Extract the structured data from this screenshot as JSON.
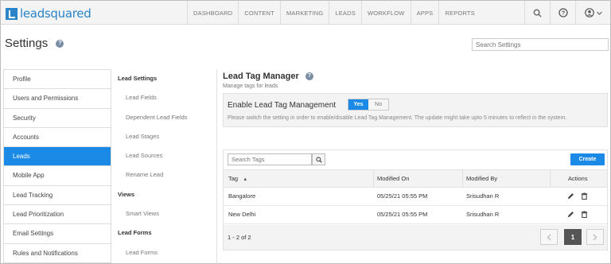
{
  "brand": {
    "name": "leadsquared"
  },
  "nav": {
    "items": [
      "DASHBOARD",
      "CONTENT",
      "MARKETING",
      "LEADS",
      "WORKFLOW",
      "APPS",
      "REPORTS"
    ]
  },
  "header": {
    "title": "Settings",
    "help_glyph": "?",
    "search_placeholder": "Search Settings"
  },
  "sidebar": {
    "items": [
      {
        "label": "Profile"
      },
      {
        "label": "Users and Permissions"
      },
      {
        "label": "Security"
      },
      {
        "label": "Accounts"
      },
      {
        "label": "Leads"
      },
      {
        "label": "Mobile App"
      },
      {
        "label": "Lead Tracking"
      },
      {
        "label": "Lead Prioritization"
      },
      {
        "label": "Email Settings"
      },
      {
        "label": "Rules and Notifications"
      }
    ],
    "active": "Leads"
  },
  "subnav": {
    "lead_settings_heading": "Lead Settings",
    "lead_settings_items": [
      "Lead Fields",
      "Dependent Lead Fields",
      "Lead Stages",
      "Lead Sources",
      "Rename Lead"
    ],
    "views_heading": "Views",
    "views_items": [
      "Smart Views"
    ],
    "lead_forms_heading": "Lead Forms",
    "lead_forms_items": [
      "Lead Forms"
    ]
  },
  "main": {
    "title": "Lead Tag Manager",
    "subtitle": "Manage tags for leads",
    "enable_label": "Enable Lead Tag Management",
    "toggle_yes": "Yes",
    "toggle_no": "No",
    "toggle_value": "Yes",
    "note": "Please switch the setting in order to enable/disable Lead Tag Management. The update might take upto 5 minutes to reflect in the system."
  },
  "table": {
    "search_placeholder": "Search Tags",
    "create_label": "Create",
    "columns": {
      "tag": "Tag",
      "sort_glyph": "▲",
      "modified_on": "Modified On",
      "modified_by": "Modified By",
      "actions": "Actions"
    },
    "rows": [
      {
        "tag": "Bangalore",
        "modified_on": "05/25/21 05:55 PM",
        "modified_by": "Srisudhan R"
      },
      {
        "tag": "New Delhi",
        "modified_on": "05/25/21 05:55 PM",
        "modified_by": "Srisudhan R"
      }
    ],
    "count_text": "1 - 2 of 2",
    "current_page": "1"
  },
  "colors": {
    "accent": "#1a8ae6",
    "brand": "#2a84c7"
  },
  "icons": [
    "search-icon",
    "help-icon",
    "user-icon",
    "edit-icon",
    "delete-icon",
    "chevron-left-icon",
    "chevron-right-icon"
  ]
}
